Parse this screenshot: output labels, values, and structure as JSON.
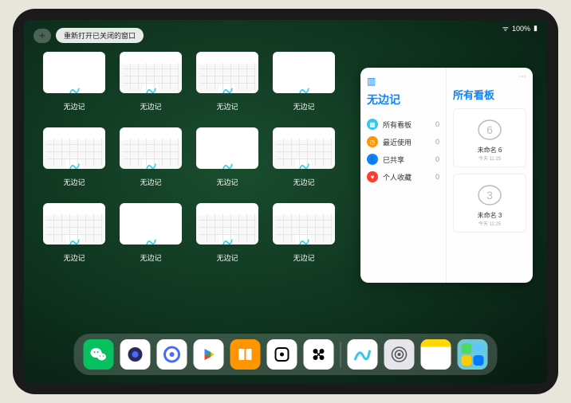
{
  "status": {
    "battery": "100%",
    "wifi": "signal"
  },
  "topbar": {
    "plus": "+",
    "reopen_label": "重新打开已关闭的窗口"
  },
  "app": {
    "name": "无边记"
  },
  "windows": [
    {
      "label": "无边记",
      "kind": "blank"
    },
    {
      "label": "无边记",
      "kind": "cal"
    },
    {
      "label": "无边记",
      "kind": "cal"
    },
    {
      "label": "无边记",
      "kind": "blank"
    },
    {
      "label": "无边记",
      "kind": "cal"
    },
    {
      "label": "无边记",
      "kind": "cal"
    },
    {
      "label": "无边记",
      "kind": "blank"
    },
    {
      "label": "无边记",
      "kind": "cal"
    },
    {
      "label": "无边记",
      "kind": "cal"
    },
    {
      "label": "无边记",
      "kind": "blank"
    },
    {
      "label": "无边记",
      "kind": "cal"
    },
    {
      "label": "无边记",
      "kind": "cal"
    }
  ],
  "stage": {
    "left_title": "无边记",
    "items": [
      {
        "icon": "grid",
        "color": "#34c8eb",
        "label": "所有看板",
        "count": "0"
      },
      {
        "icon": "clock",
        "color": "#ff9500",
        "label": "最近使用",
        "count": "0"
      },
      {
        "icon": "person",
        "color": "#0a84ff",
        "label": "已共享",
        "count": "0"
      },
      {
        "icon": "heart",
        "color": "#ff3b30",
        "label": "个人收藏",
        "count": "0"
      }
    ],
    "right_title": "所有看板",
    "boards": [
      {
        "glyph": "6",
        "name": "未命名 6",
        "time": "今天 11:25"
      },
      {
        "glyph": "3",
        "name": "未命名 3",
        "time": "今天 11:25"
      }
    ]
  },
  "dock": {
    "apps": [
      {
        "name": "wechat",
        "bg": "#07c160"
      },
      {
        "name": "quark-hd",
        "bg": "#ffffff"
      },
      {
        "name": "quark",
        "bg": "#ffffff"
      },
      {
        "name": "play",
        "bg": "#ffffff"
      },
      {
        "name": "books",
        "bg": "#ff9500"
      },
      {
        "name": "dice",
        "bg": "#ffffff"
      },
      {
        "name": "connect",
        "bg": "#ffffff"
      }
    ],
    "recent": [
      {
        "name": "freeform",
        "bg": "#ffffff"
      },
      {
        "name": "settings",
        "bg": "#e5e5ea"
      },
      {
        "name": "notes",
        "bg": "#ffffff"
      },
      {
        "name": "app-library",
        "bg": "#6ec8d8"
      }
    ]
  }
}
